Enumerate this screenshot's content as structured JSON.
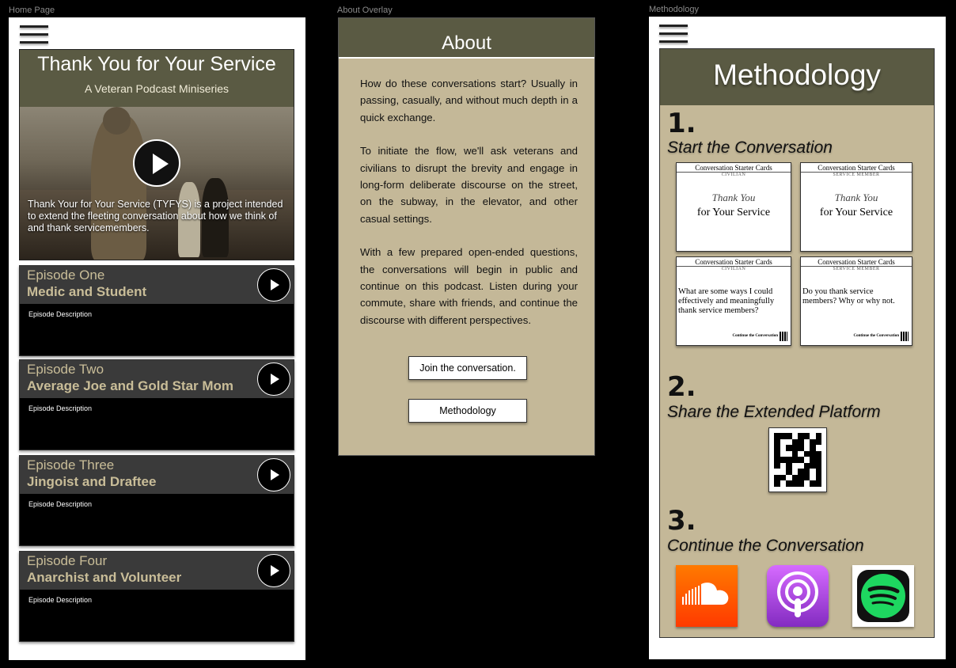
{
  "frames": {
    "home_label": "Home Page",
    "about_label": "About Overlay",
    "method_label": "Methodology"
  },
  "home": {
    "hero_title": "Thank You for Your Service",
    "hero_subtitle": "A Veteran Podcast Miniseries",
    "hero_text": "Thank Your for Your Service (TYFYS) is a project intended to extend the fleeting conversation about how we think of and thank servicemembers.",
    "episodes": [
      {
        "number": "Episode One",
        "title": "Medic and Student",
        "description": "Episode Description"
      },
      {
        "number": "Episode Two",
        "title": "Average Joe and Gold Star Mom",
        "description": "Episode Description"
      },
      {
        "number": "Episode Three",
        "title": "Jingoist and Draftee",
        "description": "Episode Description"
      },
      {
        "number": "Episode Four",
        "title": "Anarchist and Volunteer",
        "description": "Episode Description"
      }
    ]
  },
  "about": {
    "title": "About",
    "paragraphs": [
      "How do these conversations start? Usually in passing, casually, and without much depth in a quick exchange.",
      "To initiate the flow, we'll ask veterans and civilians to disrupt the brevity and engage in long-form deliberate discourse on the street, on the subway, in the elevator, and other casual settings.",
      "With a few prepared open-ended questions, the conversations will begin in public and continue on this podcast. Listen during your commute, share with friends, and continue the discourse with different perspectives."
    ],
    "join_button": "Join the conversation.",
    "methodology_button": "Methodology"
  },
  "methodology": {
    "title": "Methodology",
    "steps": [
      {
        "num": "1.",
        "label": "Start the Conversation"
      },
      {
        "num": "2.",
        "label": "Share the Extended Platform"
      },
      {
        "num": "3.",
        "label": "Continue the Conversation"
      }
    ],
    "cards": [
      {
        "header": "Conversation Starter Cards",
        "tag": "CIVILIAN",
        "line1": "Thank You",
        "line2": "for Your Service"
      },
      {
        "header": "Conversation Starter Cards",
        "tag": "SERVICE MEMBER",
        "line1": "Thank You",
        "line2": "for Your Service"
      },
      {
        "header": "Conversation Starter Cards",
        "tag": "CIVILIAN",
        "question": "What are some ways I could effectively and meaningfully thank service members?",
        "footer": "Continue the Conversation"
      },
      {
        "header": "Conversation Starter Cards",
        "tag": "SERVICE MEMBER",
        "question": "Do you thank service members? Why or why not.",
        "footer": "Continue the Conversation"
      }
    ],
    "apps": [
      {
        "name": "soundcloud-icon",
        "color": "#ff5500"
      },
      {
        "name": "apple-podcasts-icon",
        "color": "#9b3fe0"
      },
      {
        "name": "spotify-icon",
        "color": "#1ed760"
      }
    ]
  },
  "colors": {
    "olive": "#5a5a43",
    "tan": "#c4b898",
    "episode_gold": "#c9bd98"
  }
}
